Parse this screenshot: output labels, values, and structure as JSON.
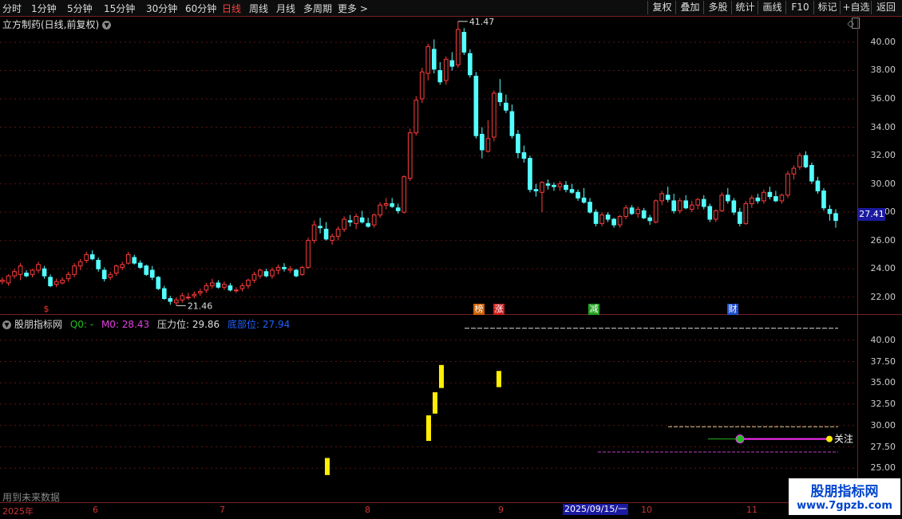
{
  "toolbar": {
    "periods": [
      "分时",
      "1分钟",
      "5分钟",
      "15分钟",
      "30分钟",
      "60分钟",
      "日线",
      "周线",
      "月线",
      "多周期",
      "更多 >"
    ],
    "active": "日线",
    "buttons": [
      "复权",
      "叠加",
      "多股",
      "统计",
      "画线",
      "F10",
      "+自选",
      "返回"
    ],
    "mark_label": "标记"
  },
  "title": "立方制药(日线,前复权)",
  "price_axis": [
    "40.00",
    "38.00",
    "36.00",
    "34.00",
    "32.00",
    "30.00",
    "28.00",
    "26.00",
    "24.00",
    "22.00"
  ],
  "last_price": "27.41",
  "high_label": "41.47",
  "low_label": "21.46",
  "event_badges": [
    {
      "text": "$",
      "color": "#ff3030"
    },
    {
      "text": "榜",
      "color": "#d06000"
    },
    {
      "text": "涨",
      "color": "#cc2020"
    },
    {
      "text": "减",
      "color": "#20a020"
    },
    {
      "text": "财",
      "color": "#2050d0"
    }
  ],
  "indicator": {
    "name": "股朋指标网",
    "q0": "Q0: -",
    "m0": "M0: 28.43",
    "pressure": "压力位: 29.86",
    "bottom": "底部位: 27.94",
    "colors": {
      "name": "#dddddd",
      "q0": "#20c020",
      "m0": "#e040e0",
      "pressure": "#dddddd",
      "bottom": "#2060ff"
    },
    "axis": [
      "40.00",
      "37.50",
      "35.00",
      "32.50",
      "30.00",
      "27.50",
      "25.00"
    ],
    "attention_label": "关注"
  },
  "future_data": "用到未来数据",
  "time_axis": {
    "labels": [
      "2025年",
      "6",
      "7",
      "8",
      "9",
      "10",
      "11"
    ],
    "cursor_date": "2025/09/15/一"
  },
  "watermark": {
    "line1": "股朋指标网",
    "line2": "www.7gpzb.com"
  },
  "chart_data": {
    "type": "candlestick",
    "ylim": [
      20.8,
      41.8
    ],
    "candles": [
      [
        23.1,
        23.4,
        22.9,
        23.2
      ],
      [
        23.0,
        23.6,
        22.8,
        23.5
      ],
      [
        23.5,
        24.0,
        23.3,
        23.8
      ],
      [
        23.6,
        24.4,
        23.2,
        24.2
      ],
      [
        23.7,
        23.9,
        23.4,
        23.5
      ],
      [
        23.6,
        24.0,
        23.4,
        23.9
      ],
      [
        23.9,
        24.5,
        23.7,
        24.3
      ],
      [
        24.0,
        24.2,
        23.3,
        23.5
      ],
      [
        23.4,
        23.6,
        22.7,
        22.8
      ],
      [
        22.9,
        23.3,
        22.7,
        23.1
      ],
      [
        23.0,
        23.4,
        22.9,
        23.2
      ],
      [
        23.3,
        23.8,
        23.1,
        23.6
      ],
      [
        23.6,
        24.4,
        23.4,
        24.2
      ],
      [
        24.2,
        24.7,
        23.9,
        24.5
      ],
      [
        24.6,
        25.2,
        24.4,
        25.0
      ],
      [
        25.0,
        25.3,
        24.6,
        24.7
      ],
      [
        24.6,
        24.8,
        23.8,
        24.0
      ],
      [
        23.9,
        24.1,
        23.1,
        23.3
      ],
      [
        23.4,
        23.8,
        23.2,
        23.6
      ],
      [
        23.7,
        24.3,
        23.5,
        24.2
      ],
      [
        24.1,
        24.5,
        23.9,
        24.3
      ],
      [
        24.4,
        25.2,
        24.3,
        25.0
      ],
      [
        24.8,
        25.0,
        24.3,
        24.4
      ],
      [
        24.4,
        24.6,
        24.0,
        24.1
      ],
      [
        24.2,
        24.3,
        23.5,
        23.6
      ],
      [
        23.9,
        24.2,
        23.2,
        23.4
      ],
      [
        23.4,
        23.5,
        22.5,
        22.6
      ],
      [
        22.6,
        22.8,
        21.8,
        21.9
      ],
      [
        21.9,
        22.1,
        21.46,
        21.7
      ],
      [
        21.6,
        22.0,
        21.4,
        21.8
      ],
      [
        21.8,
        22.3,
        21.6,
        22.1
      ],
      [
        22.0,
        22.3,
        21.8,
        22.0
      ],
      [
        22.1,
        22.4,
        21.9,
        22.2
      ],
      [
        22.3,
        22.6,
        22.1,
        22.4
      ],
      [
        22.5,
        23.0,
        22.3,
        22.8
      ],
      [
        22.8,
        23.3,
        22.6,
        23.0
      ],
      [
        23.0,
        23.2,
        22.6,
        22.7
      ],
      [
        22.7,
        23.1,
        22.5,
        22.9
      ],
      [
        22.8,
        23.0,
        22.4,
        22.5
      ],
      [
        22.5,
        22.7,
        22.3,
        22.5
      ],
      [
        22.6,
        23.0,
        22.4,
        22.8
      ],
      [
        22.8,
        23.3,
        22.6,
        23.2
      ],
      [
        23.2,
        23.8,
        23.0,
        23.6
      ],
      [
        23.5,
        24.0,
        23.3,
        23.9
      ],
      [
        23.8,
        24.0,
        23.4,
        23.5
      ],
      [
        23.5,
        24.1,
        23.3,
        23.9
      ],
      [
        23.9,
        24.3,
        23.6,
        24.1
      ],
      [
        24.1,
        24.4,
        23.8,
        24.0
      ],
      [
        23.9,
        24.2,
        23.7,
        24.0
      ],
      [
        23.9,
        24.0,
        23.4,
        23.5
      ],
      [
        23.6,
        24.2,
        23.5,
        24.1
      ],
      [
        24.1,
        26.2,
        24.0,
        26.0
      ],
      [
        26.0,
        27.4,
        25.8,
        27.1
      ],
      [
        27.0,
        27.6,
        26.5,
        26.9
      ],
      [
        26.8,
        27.3,
        26.0,
        26.1
      ],
      [
        26.0,
        26.5,
        25.7,
        26.3
      ],
      [
        26.3,
        27.0,
        26.0,
        26.8
      ],
      [
        26.8,
        27.7,
        26.6,
        27.5
      ],
      [
        27.4,
        27.8,
        27.0,
        27.3
      ],
      [
        27.2,
        27.9,
        26.8,
        27.7
      ],
      [
        27.6,
        28.1,
        27.2,
        27.3
      ],
      [
        27.2,
        27.6,
        26.9,
        27.0
      ],
      [
        27.1,
        27.9,
        26.9,
        27.8
      ],
      [
        27.8,
        28.7,
        27.6,
        28.5
      ],
      [
        28.5,
        29.0,
        28.2,
        28.6
      ],
      [
        28.6,
        29.0,
        28.3,
        28.4
      ],
      [
        28.3,
        28.6,
        27.9,
        28.1
      ],
      [
        28.0,
        30.6,
        27.9,
        30.5
      ],
      [
        30.4,
        33.9,
        30.2,
        33.6
      ],
      [
        33.6,
        36.2,
        33.4,
        35.9
      ],
      [
        36.0,
        38.2,
        35.7,
        37.9
      ],
      [
        37.8,
        39.9,
        37.3,
        39.7
      ],
      [
        39.5,
        40.2,
        37.8,
        38.1
      ],
      [
        38.0,
        38.6,
        37.0,
        37.2
      ],
      [
        37.3,
        39.0,
        37.0,
        38.8
      ],
      [
        38.7,
        39.3,
        38.0,
        38.3
      ],
      [
        38.4,
        41.47,
        38.2,
        40.9
      ],
      [
        40.7,
        41.0,
        39.1,
        39.3
      ],
      [
        39.2,
        39.5,
        37.5,
        37.7
      ],
      [
        37.6,
        37.9,
        33.2,
        33.4
      ],
      [
        33.5,
        34.0,
        31.8,
        32.4
      ],
      [
        32.3,
        34.5,
        32.2,
        33.2
      ],
      [
        33.3,
        36.6,
        33.0,
        36.4
      ],
      [
        36.4,
        37.4,
        35.5,
        35.8
      ],
      [
        35.7,
        36.3,
        35.0,
        35.2
      ],
      [
        35.1,
        35.6,
        33.2,
        33.4
      ],
      [
        33.5,
        33.8,
        31.8,
        32.2
      ],
      [
        32.2,
        32.7,
        31.5,
        31.8
      ],
      [
        31.8,
        32.0,
        29.4,
        29.6
      ],
      [
        29.6,
        30.0,
        29.1,
        29.5
      ],
      [
        29.4,
        30.2,
        28.0,
        30.1
      ],
      [
        30.0,
        30.3,
        29.6,
        29.9
      ],
      [
        29.9,
        30.1,
        29.5,
        29.8
      ],
      [
        29.8,
        30.2,
        29.5,
        30.0
      ],
      [
        29.9,
        30.2,
        29.4,
        29.6
      ],
      [
        29.6,
        30.0,
        29.3,
        29.4
      ],
      [
        29.4,
        29.6,
        28.8,
        29.0
      ],
      [
        29.0,
        29.7,
        28.6,
        28.7
      ],
      [
        28.7,
        29.0,
        27.9,
        28.0
      ],
      [
        28.0,
        28.2,
        27.0,
        27.2
      ],
      [
        27.2,
        28.0,
        27.0,
        27.8
      ],
      [
        27.8,
        28.0,
        27.3,
        27.5
      ],
      [
        27.5,
        27.6,
        26.9,
        27.1
      ],
      [
        27.1,
        27.8,
        26.9,
        27.7
      ],
      [
        27.7,
        28.5,
        27.5,
        28.3
      ],
      [
        28.3,
        28.5,
        27.8,
        27.9
      ],
      [
        27.9,
        28.4,
        27.6,
        28.2
      ],
      [
        28.1,
        28.3,
        27.5,
        27.6
      ],
      [
        27.6,
        27.8,
        27.1,
        27.4
      ],
      [
        27.3,
        28.9,
        27.2,
        28.8
      ],
      [
        28.8,
        29.5,
        28.5,
        29.3
      ],
      [
        29.2,
        29.8,
        28.7,
        28.9
      ],
      [
        28.8,
        29.3,
        27.9,
        28.1
      ],
      [
        28.1,
        29.0,
        27.9,
        28.8
      ],
      [
        28.8,
        29.2,
        28.2,
        28.3
      ],
      [
        28.2,
        28.8,
        28.0,
        28.5
      ],
      [
        28.5,
        29.0,
        28.2,
        28.9
      ],
      [
        28.9,
        29.2,
        28.2,
        28.4
      ],
      [
        28.4,
        28.6,
        27.3,
        27.5
      ],
      [
        27.5,
        28.2,
        27.3,
        28.1
      ],
      [
        28.1,
        29.4,
        28.0,
        29.2
      ],
      [
        29.2,
        29.7,
        28.6,
        28.8
      ],
      [
        28.8,
        29.0,
        27.8,
        28.0
      ],
      [
        28.0,
        28.3,
        27.0,
        27.2
      ],
      [
        27.2,
        28.8,
        27.1,
        28.6
      ],
      [
        28.6,
        29.2,
        28.3,
        29.0
      ],
      [
        29.0,
        29.3,
        28.6,
        28.8
      ],
      [
        28.8,
        29.6,
        28.6,
        29.4
      ],
      [
        29.4,
        29.8,
        28.9,
        29.1
      ],
      [
        29.1,
        29.5,
        28.7,
        28.8
      ],
      [
        28.8,
        29.3,
        28.6,
        29.2
      ],
      [
        29.2,
        30.9,
        29.0,
        30.7
      ],
      [
        30.7,
        31.3,
        30.3,
        31.1
      ],
      [
        31.2,
        32.2,
        31.0,
        32.0
      ],
      [
        32.0,
        32.3,
        31.1,
        31.2
      ],
      [
        31.3,
        31.5,
        30.0,
        30.2
      ],
      [
        30.2,
        30.5,
        29.3,
        29.5
      ],
      [
        29.5,
        29.7,
        28.1,
        28.3
      ],
      [
        28.2,
        28.5,
        27.4,
        27.9
      ],
      [
        27.9,
        28.2,
        26.9,
        27.41
      ]
    ]
  }
}
